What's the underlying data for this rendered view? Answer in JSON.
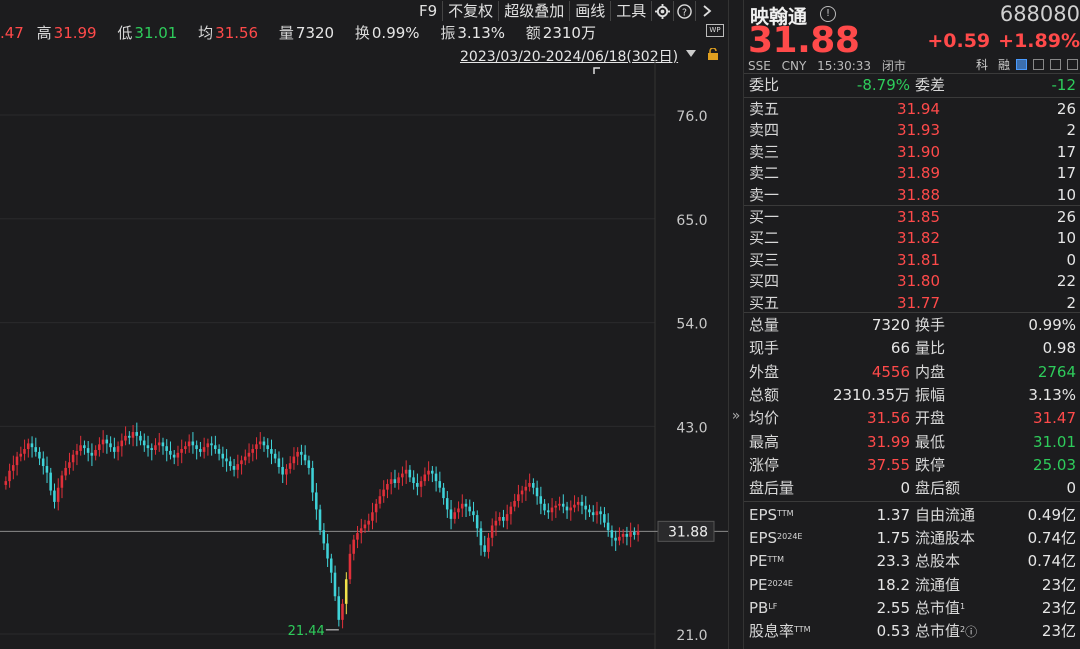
{
  "quote_row": {
    "open_value": ".47",
    "high_label": "高",
    "high_value": "31.99",
    "low_label": "低",
    "low_value": "31.01",
    "avg_label": "均",
    "avg_value": "31.56",
    "vol_label": "量",
    "vol_value": "7320",
    "turnover_label": "换",
    "turnover_value": "0.99%",
    "amp_label": "振",
    "amp_value": "3.13%",
    "amount_label": "额",
    "amount_value": "2310万"
  },
  "toolbar": {
    "f9": "F9",
    "no_adjust": "不复权",
    "overlay": "超级叠加",
    "draw": "画线",
    "tools": "工具"
  },
  "wp_badge": "WP",
  "date_range": "2023/03/20-2024/06/18(302日)",
  "chart_data": {
    "type": "candlestick",
    "y_ticks": [
      76.0,
      65.0,
      54.0,
      43.0,
      21.0
    ],
    "ylim": [
      21.0,
      76.0
    ],
    "current_price_label": "31.88",
    "min_marker": "21.44",
    "price_line": 31.88,
    "closes": [
      37.2,
      38.3,
      38.9,
      39.8,
      40.1,
      40.6,
      41.2,
      40.8,
      40.3,
      39.6,
      38.8,
      38.1,
      36.2,
      35.0,
      36.5,
      37.8,
      38.6,
      39.2,
      40.0,
      40.4,
      41.0,
      40.7,
      40.2,
      39.9,
      40.5,
      41.1,
      41.6,
      41.2,
      40.8,
      40.3,
      40.9,
      41.5,
      42.0,
      41.8,
      42.4,
      42.0,
      41.5,
      41.0,
      40.7,
      40.5,
      41.0,
      41.3,
      40.9,
      40.4,
      40.0,
      39.7,
      40.2,
      40.6,
      40.9,
      41.4,
      41.0,
      40.6,
      40.3,
      40.8,
      41.2,
      41.0,
      40.6,
      40.1,
      39.6,
      39.3,
      38.8,
      38.4,
      39.0,
      39.4,
      39.8,
      40.2,
      40.6,
      41.1,
      41.4,
      41.0,
      40.6,
      40.1,
      39.6,
      38.7,
      37.9,
      38.5,
      39.1,
      39.8,
      40.3,
      40.0,
      39.4,
      38.6,
      36.0,
      34.2,
      32.0,
      30.6,
      29.0,
      27.5,
      25.0,
      22.5,
      24.2,
      26.8,
      29.5,
      31.0,
      31.7,
      32.2,
      32.6,
      33.0,
      33.9,
      34.8,
      35.6,
      36.3,
      36.9,
      37.4,
      37.0,
      37.6,
      38.0,
      38.4,
      37.6,
      37.0,
      36.6,
      37.2,
      37.9,
      38.3,
      38.0,
      37.2,
      36.5,
      35.4,
      34.2,
      33.2,
      33.9,
      34.3,
      34.8,
      34.5,
      34.0,
      33.6,
      32.2,
      30.4,
      29.7,
      31.2,
      32.5,
      33.0,
      33.4,
      33.0,
      33.7,
      34.5,
      35.1,
      35.8,
      36.2,
      36.6,
      37.0,
      36.5,
      35.6,
      34.8,
      34.1,
      33.9,
      34.4,
      34.6,
      34.8,
      34.5,
      34.1,
      34.4,
      34.7,
      35.0,
      34.6,
      34.2,
      33.9,
      33.6,
      34.0,
      33.7,
      32.8,
      32.0,
      31.2,
      30.9,
      31.3,
      31.6,
      31.3,
      31.8,
      31.5,
      31.88
    ],
    "highlight_candle_index": 91
  },
  "panel": {
    "stock_name": "映翰通",
    "stock_code": "688080",
    "price": "31.88",
    "change": "+0.59",
    "change_pct": "+1.89%",
    "exchange": "SSE",
    "currency": "CNY",
    "time": "15:30:33",
    "status": "闭市",
    "tag_margin": "科",
    "tag_finance": "融",
    "order_ratio_label": "委比",
    "order_ratio_value": "-8.79%",
    "order_diff_label": "委差",
    "order_diff_value": "-12",
    "asks": [
      {
        "label": "卖五",
        "price": "31.94",
        "qty": "26"
      },
      {
        "label": "卖四",
        "price": "31.93",
        "qty": "2"
      },
      {
        "label": "卖三",
        "price": "31.90",
        "qty": "17"
      },
      {
        "label": "卖二",
        "price": "31.89",
        "qty": "17"
      },
      {
        "label": "卖一",
        "price": "31.88",
        "qty": "10"
      }
    ],
    "bids": [
      {
        "label": "买一",
        "price": "31.85",
        "qty": "26"
      },
      {
        "label": "买二",
        "price": "31.82",
        "qty": "10"
      },
      {
        "label": "买三",
        "price": "31.81",
        "qty": "0"
      },
      {
        "label": "买四",
        "price": "31.80",
        "qty": "22"
      },
      {
        "label": "买五",
        "price": "31.77",
        "qty": "2"
      }
    ],
    "stats": [
      {
        "l1": "总量",
        "v1": "7320",
        "c1": "white",
        "l2": "换手",
        "v2": "0.99%",
        "c2": "white"
      },
      {
        "l1": "现手",
        "v1": "66",
        "c1": "white",
        "l2": "量比",
        "v2": "0.98",
        "c2": "white"
      },
      {
        "l1": "外盘",
        "v1": "4556",
        "c1": "red",
        "l2": "内盘",
        "v2": "2764",
        "c2": "green"
      },
      {
        "l1": "总额",
        "v1": "2310.35万",
        "c1": "white",
        "l2": "振幅",
        "v2": "3.13%",
        "c2": "white"
      },
      {
        "l1": "均价",
        "v1": "31.56",
        "c1": "red",
        "l2": "开盘",
        "v2": "31.47",
        "c2": "red"
      },
      {
        "l1": "最高",
        "v1": "31.99",
        "c1": "red",
        "l2": "最低",
        "v2": "31.01",
        "c2": "green"
      },
      {
        "l1": "涨停",
        "v1": "37.55",
        "c1": "red",
        "l2": "跌停",
        "v2": "25.03",
        "c2": "green"
      },
      {
        "l1": "盘后量",
        "v1": "0",
        "c1": "white",
        "l2": "盘后额",
        "v2": "0",
        "c2": "white"
      }
    ],
    "fundamentals": [
      {
        "l1": "EPS",
        "s1": "TTM",
        "v1": "1.37",
        "l2": "自由流通",
        "s2": "",
        "v2": "0.49亿"
      },
      {
        "l1": "EPS",
        "s1": "2024E",
        "v1": "1.75",
        "l2": "流通股本",
        "s2": "",
        "v2": "0.74亿"
      },
      {
        "l1": "PE",
        "s1": "TTM",
        "v1": "23.3",
        "l2": "总股本",
        "s2": "",
        "v2": "0.74亿"
      },
      {
        "l1": "PE",
        "s1": "2024E",
        "v1": "18.2",
        "l2": "流通值",
        "s2": "",
        "v2": "23亿"
      },
      {
        "l1": "PB",
        "s1": "LF",
        "v1": "2.55",
        "l2": "总市值",
        "s2": "1",
        "v2": "23亿"
      },
      {
        "l1": "股息率",
        "s1": "TTM",
        "v1": "0.53",
        "l2": "总市值",
        "s2": "2",
        "v2": "23亿"
      }
    ]
  },
  "colors": {
    "up": "#ff4a4a",
    "down": "#2ecc5b",
    "candle_down": "#3fd2d8",
    "candle_up": "#e0303a",
    "highlight": "#f2e34a"
  }
}
